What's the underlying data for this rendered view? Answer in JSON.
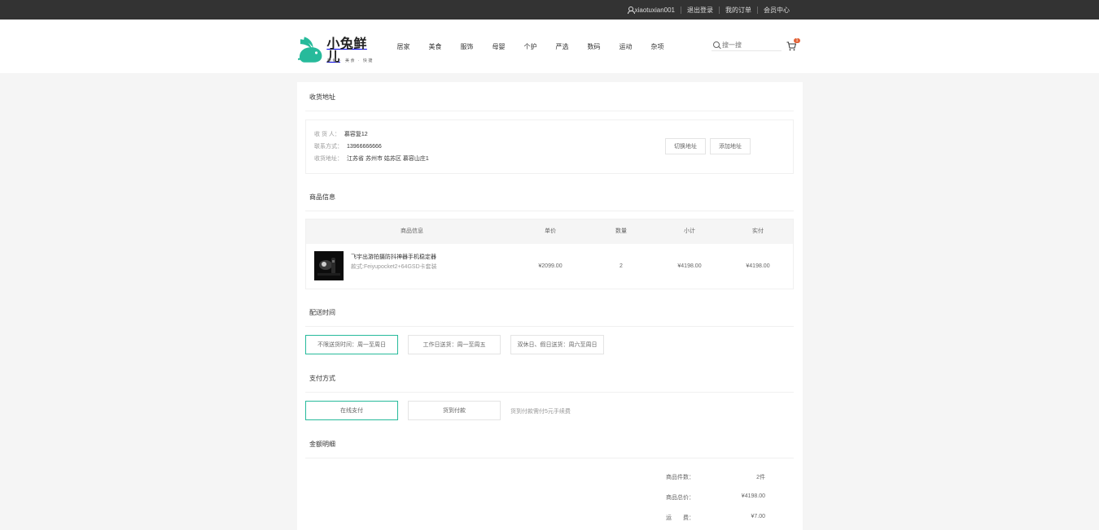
{
  "topbar": {
    "username": "xiaotuxian001",
    "logout": "退出登录",
    "orders": "我的订单",
    "member": "会员中心"
  },
  "logo": {
    "name": "小兔鲜儿",
    "tagline": "新鲜 · 美食 · 快捷",
    "color": "#27ba9b"
  },
  "nav": [
    "居家",
    "美食",
    "服饰",
    "母婴",
    "个护",
    "严选",
    "数码",
    "运动",
    "杂项"
  ],
  "search": {
    "placeholder": "搜一搜"
  },
  "cart": {
    "count": "1"
  },
  "checkout": {
    "address": {
      "title": "收货地址",
      "receiver_label": "收 货 人：",
      "receiver": "慕容复12",
      "phone_label": "联系方式：",
      "phone": "13966666666",
      "addr_label": "收货地址：",
      "addr": "江苏省 苏州市 姑苏区 慕容山庄1",
      "switch_btn": "切换地址",
      "add_btn": "添加地址"
    },
    "goods": {
      "title": "商品信息",
      "headers": [
        "商品信息",
        "单价",
        "数量",
        "小计",
        "实付"
      ],
      "items": [
        {
          "name": "飞宇出游拍摄防抖神器手机稳定器",
          "attrs": "款式:Feiyupocket2+64GSD卡套装",
          "price": "¥2099.00",
          "count": "2",
          "subtotal": "¥4198.00",
          "pay": "¥4198.00"
        }
      ]
    },
    "delivery": {
      "title": "配送时间",
      "options": [
        "不限送货时间：周一至周日",
        "工作日送货：周一至周五",
        "双休日、假日送货：周六至周日"
      ],
      "selected": 0
    },
    "payment": {
      "title": "支付方式",
      "options": [
        "在线支付",
        "货到付款"
      ],
      "selected": 0,
      "note": "货到付款需付5元手续费"
    },
    "summary": {
      "title": "金额明细",
      "rows": [
        {
          "label": "商品件数：",
          "value": "2件"
        },
        {
          "label": "商品总价：",
          "value": "¥4198.00"
        },
        {
          "label": "运　　费：",
          "value": "¥7.00"
        }
      ]
    }
  },
  "colors": {
    "topbar": "#333333",
    "accent": "#27ba9b",
    "badge": "#e26237"
  }
}
